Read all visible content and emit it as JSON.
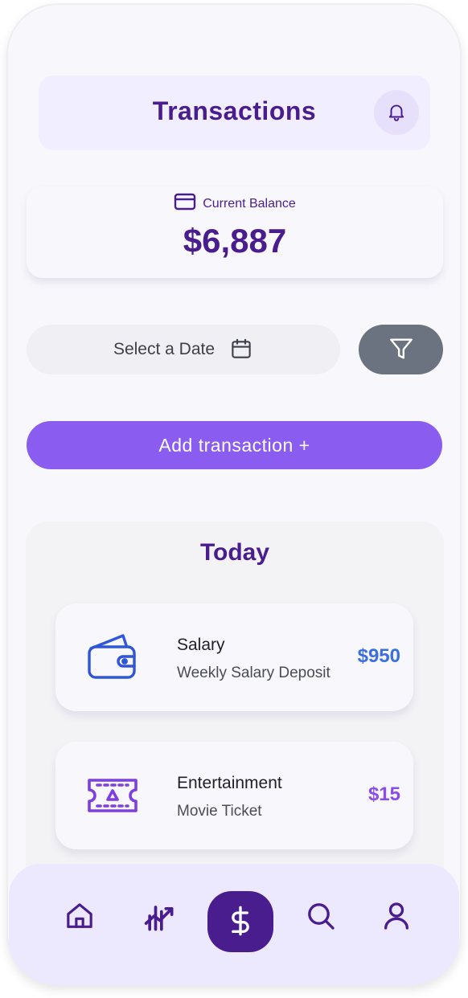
{
  "header": {
    "title": "Transactions",
    "bell_icon": "bell-icon"
  },
  "balance": {
    "icon": "credit-card-icon",
    "label": "Current Balance",
    "amount": "$6,887"
  },
  "filters": {
    "date_label": "Select a Date",
    "calendar_icon": "calendar-icon",
    "filter_icon": "filter-icon"
  },
  "actions": {
    "add_label": "Add transaction +"
  },
  "today": {
    "title": "Today",
    "transactions": [
      {
        "icon": "wallet-icon",
        "name": "Salary",
        "description": "Weekly Salary Deposit",
        "amount": "$950",
        "color": "#3b6fe0"
      },
      {
        "icon": "ticket-icon",
        "name": "Entertainment",
        "description": "Movie Ticket",
        "amount": "$15",
        "color": "#8a4ee6"
      }
    ]
  },
  "nav": {
    "items": [
      "home-icon",
      "chart-icon",
      "dollar-icon",
      "search-icon",
      "user-icon"
    ],
    "active": "dollar-icon"
  },
  "colors": {
    "primary": "#4a1d8f",
    "accent": "#8a5cf0",
    "filter": "#6b7280",
    "nav_bg": "#ece8fd"
  }
}
